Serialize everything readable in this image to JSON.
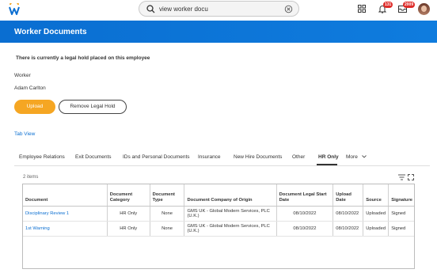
{
  "search": {
    "query": "view worker docu"
  },
  "notifications": {
    "count": "131"
  },
  "inbox": {
    "count": "2009"
  },
  "page": {
    "title": "Worker Documents"
  },
  "legal_hold_message": "There is currently a legal hold placed on this employee",
  "worker": {
    "label": "Worker",
    "name": "Adam Carlton"
  },
  "buttons": {
    "upload": "Upload",
    "remove_hold": "Remove Legal Hold"
  },
  "tab_view_link": "Tab View",
  "tabs": [
    {
      "label": "Employee Relations"
    },
    {
      "label": "Exit Documents"
    },
    {
      "label": "IDs and Personal Documents"
    },
    {
      "label": "Insurance"
    },
    {
      "label": "New Hire Documents"
    },
    {
      "label": "Other"
    },
    {
      "label": "HR Only"
    },
    {
      "label": "More"
    }
  ],
  "active_tab": "HR Only",
  "table": {
    "item_count": "2 items",
    "columns": [
      "Document",
      "Document Category",
      "Document Type",
      "Document Company of Origin",
      "Document Legal Start Date",
      "Upload Date",
      "Source",
      "Signature"
    ],
    "rows": [
      [
        "Disciplinary Review 1",
        "HR Only",
        "None",
        "GMS UK - Global Modern Services, PLC (U.K.)",
        "08/10/2022",
        "08/10/2022",
        "Uploaded",
        "Signed"
      ],
      [
        "1st Warning",
        "HR Only",
        "None",
        "GMS UK - Global Modern Services, PLC (U.K.)",
        "08/10/2022",
        "08/10/2022",
        "Uploaded",
        "Signed"
      ]
    ]
  },
  "colors": {
    "brand_blue": "#0a6ed1",
    "accent_orange": "#f5a623",
    "badge_red": "#de2c29"
  },
  "icons": [
    "workday-logo-icon",
    "search-icon",
    "clear-icon",
    "apps-grid-icon",
    "bell-icon",
    "inbox-icon",
    "filter-icon",
    "fullscreen-icon",
    "chevron-down-icon"
  ]
}
